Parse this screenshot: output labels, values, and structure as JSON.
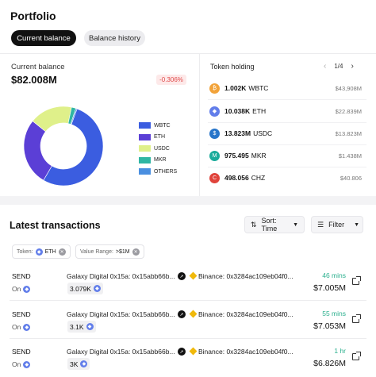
{
  "header": {
    "title": "Portfolio",
    "tabs": [
      {
        "label": "Current balance",
        "active": true
      },
      {
        "label": "Balance history",
        "active": false
      }
    ]
  },
  "balance": {
    "label": "Current balance",
    "value": "$82.008M",
    "change": "-0.306%"
  },
  "chart_data": {
    "type": "pie",
    "categories": [
      "WBTC",
      "ETH",
      "USDC",
      "MKR",
      "OTHERS"
    ],
    "values": [
      53.0,
      27.5,
      17.5,
      1.8,
      0.5
    ],
    "colors": [
      "#3b5de0",
      "#5b3fd6",
      "#dff08a",
      "#2fb6a3",
      "#4a8fe0"
    ],
    "donut": true
  },
  "legend": {
    "items": [
      {
        "label": "WBTC",
        "color": "#3b5de0"
      },
      {
        "label": "ETH",
        "color": "#5b3fd6"
      },
      {
        "label": "USDC",
        "color": "#dff08a"
      },
      {
        "label": "MKR",
        "color": "#2fb6a3"
      },
      {
        "label": "OTHERS",
        "color": "#4a8fe0"
      }
    ]
  },
  "token_holding": {
    "label": "Token holding",
    "page": "1/4",
    "tokens": [
      {
        "amount": "1.002K",
        "symbol": "WBTC",
        "usd": "$43,908M",
        "icon": "wbtc-icon",
        "color": "#f2a33a",
        "glyph": "₿"
      },
      {
        "amount": "10.038K",
        "symbol": "ETH",
        "usd": "$22.839M",
        "icon": "eth-icon",
        "color": "#627eea",
        "glyph": "◆"
      },
      {
        "amount": "13.823M",
        "symbol": "USDC",
        "usd": "$13.823M",
        "icon": "usdc-icon",
        "color": "#2775ca",
        "glyph": "$"
      },
      {
        "amount": "975.495",
        "symbol": "MKR",
        "usd": "$1.438M",
        "icon": "mkr-icon",
        "color": "#1aab9b",
        "glyph": "M"
      },
      {
        "amount": "498.056",
        "symbol": "CHZ",
        "usd": "$40.806",
        "icon": "chz-icon",
        "color": "#e0433b",
        "glyph": "C"
      }
    ]
  },
  "transactions": {
    "title": "Latest transactions",
    "sort_label": "Sort: Time",
    "filter_label": "Filter",
    "chips": [
      {
        "key": "Token:",
        "value": "ETH"
      },
      {
        "key": "Value Range:",
        "value": ">$1M"
      }
    ],
    "rows": [
      {
        "type": "SEND",
        "on": "On",
        "from": "Galaxy Digital 0x15a: 0x15abb66b...",
        "amount": "3.079K",
        "to": "Binance: 0x3284ac109eb04f0...",
        "time": "46 mins",
        "usd": "$7.005M"
      },
      {
        "type": "SEND",
        "on": "On",
        "from": "Galaxy Digital 0x15a: 0x15abb66b...",
        "amount": "3.1K",
        "to": "Binance: 0x3284ac109eb04f0...",
        "time": "55 mins",
        "usd": "$7.053M"
      },
      {
        "type": "SEND",
        "on": "On",
        "from": "Galaxy Digital 0x15a: 0x15abb66b...",
        "amount": "3K",
        "to": "Binance: 0x3284ac109eb04f0...",
        "time": "1 hr",
        "usd": "$6.826M"
      }
    ]
  }
}
